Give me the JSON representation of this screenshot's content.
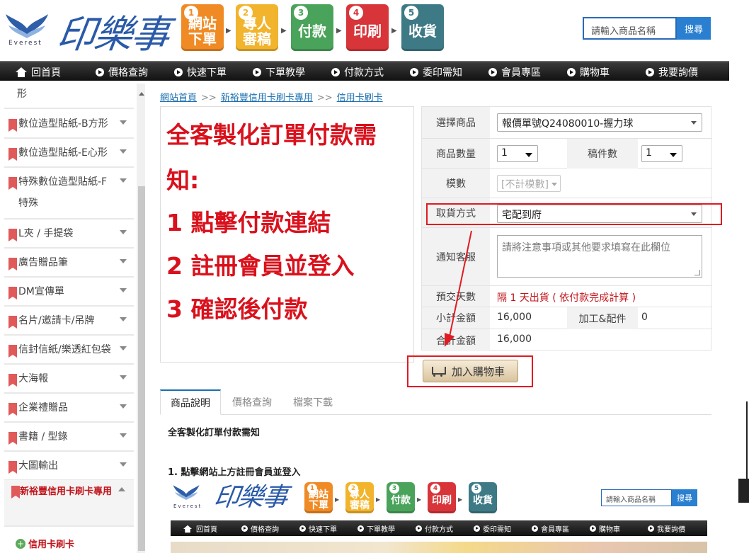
{
  "header": {
    "logo_text": "印樂事",
    "logo_sub": "Everest",
    "steps": [
      {
        "num": "1",
        "label": "網站\n下單",
        "color": "#f08a24"
      },
      {
        "num": "2",
        "label": "專人\n審稿",
        "color": "#f2b42c"
      },
      {
        "num": "3",
        "label": "付款",
        "color": "#4aa35a"
      },
      {
        "num": "4",
        "label": "印刷",
        "color": "#d8353a"
      },
      {
        "num": "5",
        "label": "收貨",
        "color": "#3d7a86"
      }
    ],
    "search_placeholder": "請輸入商品名稱",
    "search_button": "搜尋"
  },
  "nav": {
    "items": [
      "回首頁",
      "價格查詢",
      "快速下單",
      "下單教學",
      "付款方式",
      "委印需知",
      "會員專區",
      "購物車",
      "我要詢價"
    ]
  },
  "sidebar": {
    "items": [
      {
        "label": "形",
        "flag": false,
        "caret": false
      },
      {
        "label": "數位造型貼紙-B方形",
        "flag": true,
        "caret": true
      },
      {
        "label": "數位造型貼紙-E心形",
        "flag": true,
        "caret": true
      },
      {
        "label": "特殊數位造型貼紙-F",
        "label2": "特殊",
        "flag": true,
        "caret": true
      },
      {
        "label": "L夾 / 手提袋",
        "flag": true,
        "caret": true
      },
      {
        "label": "廣告贈品筆",
        "flag": true,
        "caret": true
      },
      {
        "label": "DM宣傳單",
        "flag": true,
        "caret": true
      },
      {
        "label": "名片/邀請卡/吊牌",
        "flag": true,
        "caret": true
      },
      {
        "label": "信封信紙/樂透紅包袋",
        "flag": true,
        "caret": true
      },
      {
        "label": "大海報",
        "flag": true,
        "caret": true
      },
      {
        "label": "企業禮贈品",
        "flag": true,
        "caret": true
      },
      {
        "label": "書籍 / 型錄",
        "flag": true,
        "caret": true
      },
      {
        "label": "大圖輸出",
        "flag": true,
        "caret": true
      }
    ],
    "active_group": "新裕豐信用卡刷卡專用",
    "active_child": "信用卡刷卡"
  },
  "breadcrumb": [
    "網站首頁",
    "新裕豐信用卡刷卡專用",
    "信用卡刷卡"
  ],
  "breadcrumb_sep": ">>",
  "notice": {
    "lines": [
      "全客製化訂單付款需",
      "知:",
      "1 點擊付款連結",
      "2 註冊會員並登入",
      "3 確認後付款"
    ],
    "color": "#d9111c"
  },
  "order": {
    "product_label": "選擇商品",
    "product_value": "報價單號Q24080010-握力球",
    "qty_label": "商品數量",
    "qty_value": "1",
    "copies_label": "稿件數",
    "copies_value": "1",
    "mold_label": "模數",
    "mold_value": "[不計模數]",
    "pickup_label": "取貨方式",
    "pickup_value": "宅配到府",
    "notify_label": "通知客服",
    "notify_placeholder": "請將注意事項或其他要求填寫在此欄位",
    "delivery_label": "預交天數",
    "delivery_value": "隔 1 天出貨 ( 依付款完成計算 )",
    "subtotal_label": "小計金額",
    "subtotal_value": "16,000",
    "addon_label": "加工&配件",
    "addon_value": "0",
    "total_label": "合計金額",
    "total_value": "16,000",
    "cart_button": "加入購物車"
  },
  "tabs": [
    "商品說明",
    "價格查詢",
    "檔案下載"
  ],
  "description": {
    "title": "全客製化訂單付款需知",
    "step1": "1. 點擊網站上方註冊會員並登入"
  },
  "embedded": {
    "logo_text": "印樂事",
    "logo_sub": "Everest",
    "search_placeholder": "請輸入商品名稱",
    "search_button": "搜尋",
    "nav_items": [
      "回首頁",
      "價格查詢",
      "快速下單",
      "下單教學",
      "付款方式",
      "委印需知",
      "會員專區",
      "購物車",
      "我要詢價"
    ]
  },
  "colors": {
    "accent_blue": "#1a6fb0",
    "annotation_red": "#e01b22",
    "nav_dark": "#111111"
  }
}
